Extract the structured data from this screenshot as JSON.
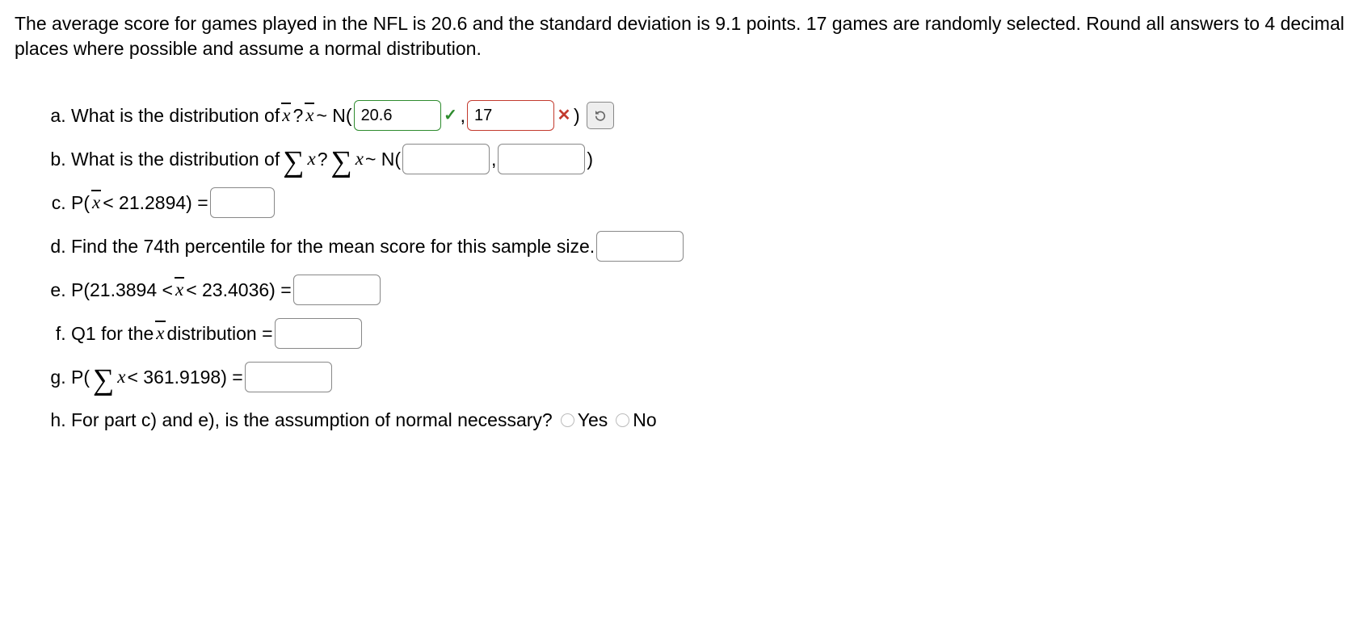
{
  "intro": "The average score for games played in the NFL is 20.6 and the standard deviation is 9.1 points. 17 games are randomly selected. Round all answers to 4 decimal places where possible and assume a normal distribution.",
  "q": {
    "a": {
      "pre": "What is the distribution of ",
      "var": "x",
      "post": "? ",
      "dist": " ~ N(",
      "mean": "20.6",
      "sd": "17",
      "close": ")"
    },
    "b": {
      "pre": "What is the distribution of ",
      "post": "? ",
      "dist": " ~ N(",
      "mean": "",
      "sd": "",
      "close": ")"
    },
    "c": {
      "pre": "P(",
      "cond": " < 21.2894) = ",
      "val": ""
    },
    "d": {
      "text": "Find the 74th percentile for the mean score for this sample size. ",
      "val": ""
    },
    "e": {
      "pre": "P(21.3894 < ",
      "post": " < 23.4036) = ",
      "val": ""
    },
    "f": {
      "pre": "Q1 for the ",
      "post": " distribution = ",
      "val": ""
    },
    "g": {
      "pre": "P(",
      "cond": " < 361.9198) = ",
      "val": ""
    },
    "h": {
      "text": "For part c) and e), is the assumption of normal necessary? ",
      "opt_yes": "Yes",
      "opt_no": "No"
    }
  },
  "icons": {
    "check": "✓",
    "cross": "✕"
  }
}
